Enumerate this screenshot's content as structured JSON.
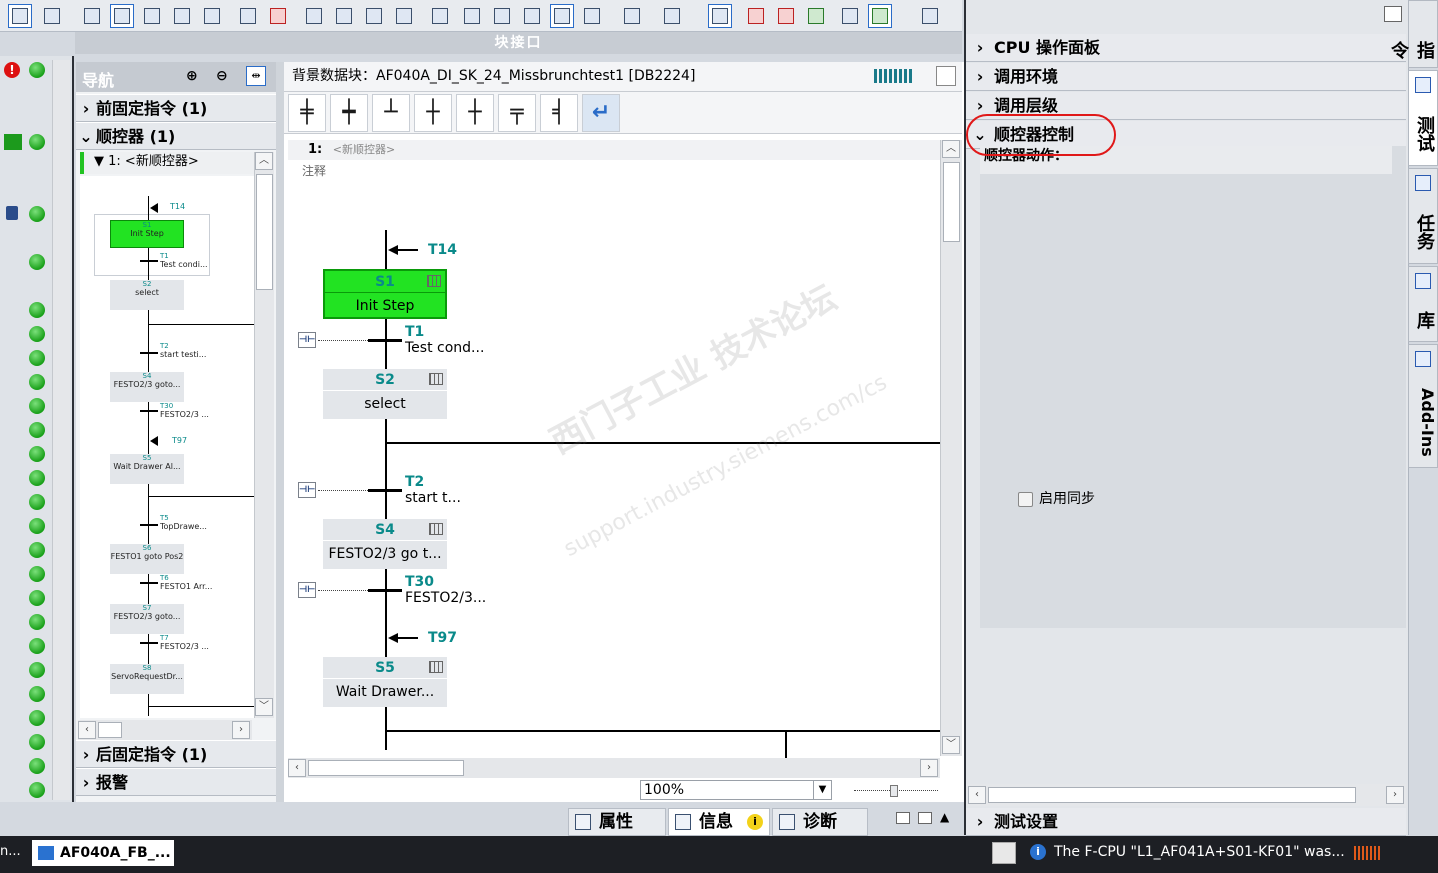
{
  "toolbar": {
    "interface_label": "块接口"
  },
  "navigation": {
    "title": "导航",
    "sections": {
      "pre": "前固定指令 (1)",
      "seq": "顺控器 (1)",
      "post": "后固定指令 (1)",
      "alarm": "报警"
    },
    "tree_item": "1: <新顺控器>",
    "mini": {
      "s1_num": "S1",
      "s1_name": "Init Step",
      "t14": "T14",
      "t1_num": "T1",
      "t1_name": "Test condi...",
      "s2_num": "S2",
      "s2_name": "select",
      "t2_num": "T2",
      "t2_name": "start testi...",
      "s4_num": "S4",
      "s4_name": "FESTO2/3 goto...",
      "t30_num": "T30",
      "t30_name": "FESTO2/3 ...",
      "t97": "T97",
      "s5_num": "S5",
      "s5_name": "Wait Drawer Al...",
      "t5_num": "T5",
      "t5_name": "TopDrawe...",
      "s6_num": "S6",
      "s6_name": "FESTO1 goto Pos2",
      "t6_num": "T6",
      "t6_name": "FESTO1 Arr...",
      "s7_num": "S7",
      "s7_name": "FESTO2/3 goto...",
      "t7_num": "T7",
      "t7_name": "FESTO2/3 ...",
      "s8_num": "S8",
      "s8_name": "ServoRequestDr..."
    }
  },
  "editor": {
    "header": "背景数据块：AF040A_DI_SK_24_Missbrunchtest1 [DB2224]",
    "seq_number": "1:",
    "seq_name": "<新顺控器>",
    "comment_label": "注释",
    "zoom": "100%",
    "jump_t14": "T14",
    "jump_t97": "T97",
    "steps": {
      "s1_num": "S1",
      "s1_name": "Init Step",
      "s2_num": "S2",
      "s2_name": "select",
      "s4_num": "S4",
      "s4_name": "FESTO2/3 go t...",
      "s5_num": "S5",
      "s5_name": "Wait Drawer..."
    },
    "transitions": {
      "t1_num": "T1",
      "t1_name": "Test cond...",
      "t2_num": "T2",
      "t2_name": "start t...",
      "t30_num": "T30",
      "t30_name": "FESTO2/3..."
    }
  },
  "right_panel": {
    "rows": {
      "cpu": "CPU 操作面板",
      "env": "调用环境",
      "level": "调用层级",
      "seqctrl": "顺控器控制",
      "test_settings": "测试设置"
    },
    "seq_action_label": "顺控器动作：",
    "sync_label": "启用同步"
  },
  "vertical_tabs": {
    "instructions": "指令",
    "test": "测试",
    "tasks": "任务",
    "library": "库",
    "addins": "Add-Ins"
  },
  "bottom_tabs": {
    "properties": "属性",
    "info": "信息",
    "diagnostics": "诊断"
  },
  "taskbar": {
    "item": "AF040A_FB_...",
    "message": "The F-CPU \"L1_AF041A+S01-KF01\" was..."
  },
  "watermark": {
    "line1": "西门子工业 技术论坛",
    "line2": "support.industry.siemens.com/cs"
  }
}
